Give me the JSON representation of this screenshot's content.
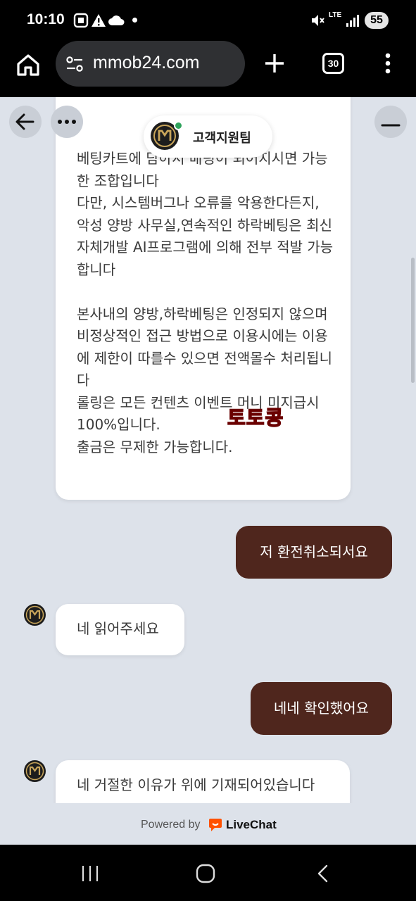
{
  "status_bar": {
    "time": "10:10",
    "network": "LTE",
    "battery": "55"
  },
  "browser": {
    "url": "mmob24.com",
    "tab_count": "30"
  },
  "chat": {
    "agent_name": "고객지원팀",
    "agent_status_color": "#2fa35c",
    "messages": [
      {
        "from": "agent",
        "text": "베팅카트에 담아서 배팅이 되어지시면 가능한 조합입니다\n다만, 시스템버그나 오류를 악용한다든지, 악성 양방 사무실,연속적인 하락베팅은 최신 자체개발 AI프로그램에 의해 전부 적발 가능합니다\n\n본사내의 양방,하락베팅은 인정되지 않으며\n비정상적인 접근 방법으로 이용시에는 이용에 제한이 따를수 있으면 전액몰수 처리됩니다\n롤링은 모든 컨텐츠 이벤트 머니 미지급시 100%입니다.\n출금은 무제한 가능합니다."
      },
      {
        "from": "user",
        "text": "저 환전취소되서요"
      },
      {
        "from": "agent",
        "text": "네 읽어주세요"
      },
      {
        "from": "user",
        "text": "네네 확인했어요"
      },
      {
        "from": "agent",
        "text": "네 거절한 이유가 위에 기재되어있습니다"
      }
    ],
    "watermark": "토토콩"
  },
  "footer": {
    "powered_by": "Powered by",
    "brand": "LiveChat",
    "brand_color": "#ff5100"
  },
  "colors": {
    "user_bubble": "#4f261d",
    "chat_background": "#dde2ea"
  }
}
